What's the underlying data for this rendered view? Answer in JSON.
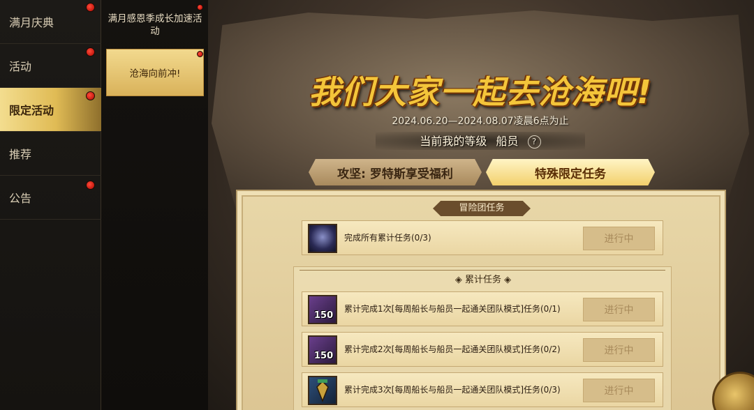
{
  "sidebar": {
    "items": [
      {
        "label": "满月庆典",
        "active": false,
        "dot": true
      },
      {
        "label": "活动",
        "active": false,
        "dot": true
      },
      {
        "label": "限定活动",
        "active": true,
        "dot": true
      },
      {
        "label": "推荐",
        "active": false,
        "dot": false
      },
      {
        "label": "公告",
        "active": false,
        "dot": true
      }
    ]
  },
  "subnav": {
    "items": [
      {
        "label": "满月感恩季成长加速活动",
        "active": false
      },
      {
        "label": "沧海向前冲!",
        "active": true
      }
    ]
  },
  "event": {
    "title": "我们大家一起去沧海吧!",
    "date_range": "2024.06.20—2024.08.07凌晨6点为止",
    "level_label": "当前我的等级",
    "level_value": "船员",
    "help_icon": "?"
  },
  "tabs": [
    {
      "label": "攻坚: 罗特斯享受福利",
      "active": false
    },
    {
      "label": "特殊限定任务",
      "active": true
    }
  ],
  "panel": {
    "header": "冒险团任务",
    "main_task": {
      "text": "完成所有累计任务(0/3)",
      "status": "进行中"
    },
    "cumulative": {
      "header": "累计任务",
      "tasks": [
        {
          "text": "累计完成1次[每周船长与船员一起通关团队模式]任务(0/1)",
          "status": "进行中",
          "badge": "150"
        },
        {
          "text": "累计完成2次[每周船长与船员一起通关团队模式]任务(0/2)",
          "status": "进行中",
          "badge": "150"
        },
        {
          "text": "累计完成3次[每周船长与船员一起通关团队模式]任务(0/3)",
          "status": "进行中",
          "badge": ""
        }
      ]
    }
  },
  "colors": {
    "accent_gold": "#f4c53a",
    "dot_red": "#d9271a",
    "panel_bg": "#e8d7a8"
  }
}
